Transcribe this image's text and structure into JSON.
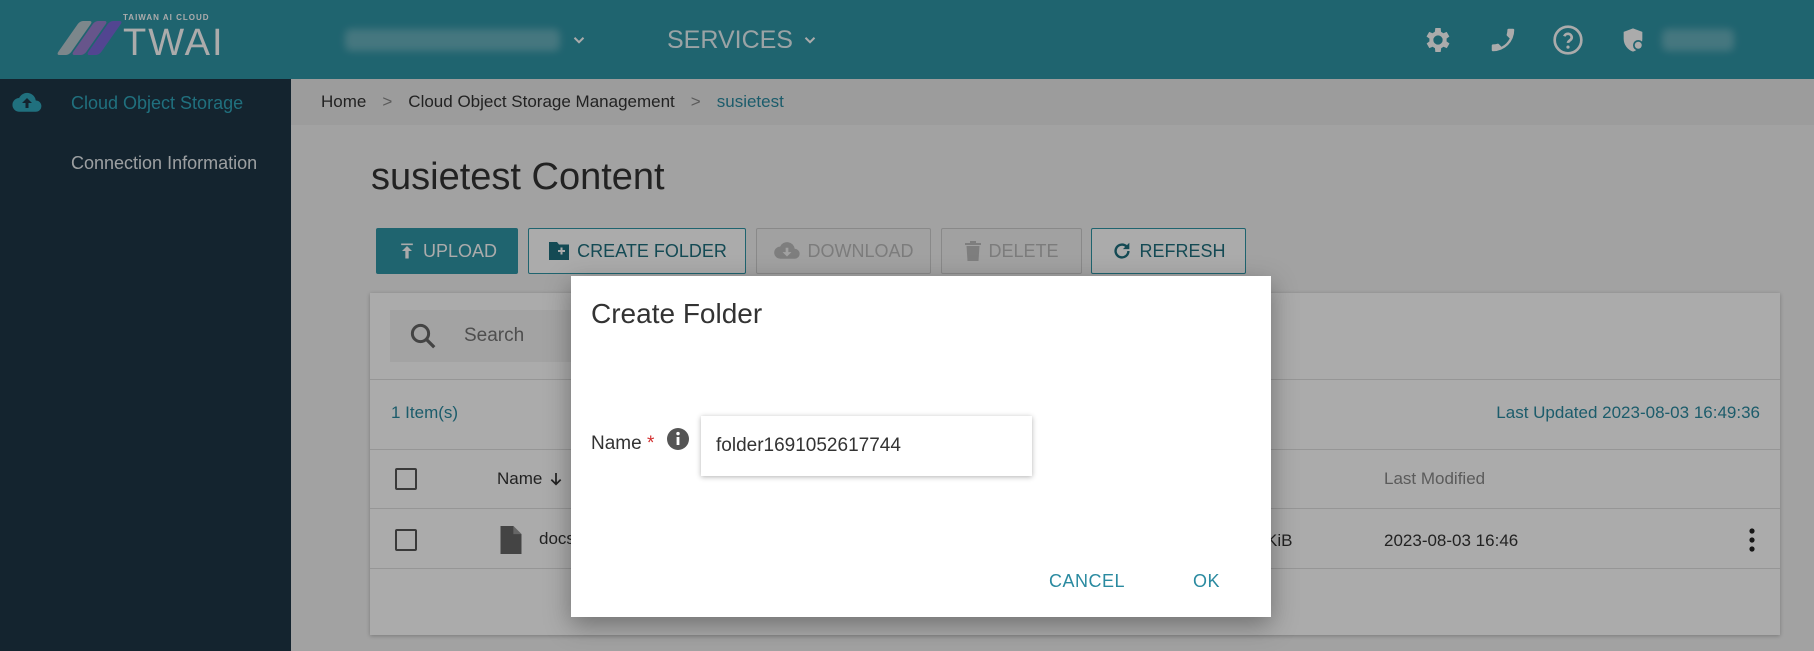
{
  "colors": {
    "primary": "#2f95a6",
    "sidebar": "#1e3646",
    "accent_text": "#2a8aa0",
    "required": "#d32f2f"
  },
  "header": {
    "logo_small": "TAIWAN AI CLOUD",
    "logo_main": "TWAI",
    "services_label": "SERVICES",
    "icons": [
      "gear-icon",
      "phone-icon",
      "help-icon",
      "user-shield-icon"
    ]
  },
  "sidebar": {
    "items": [
      {
        "label": "Cloud Object Storage",
        "icon": "cloud-upload-icon",
        "active": true
      },
      {
        "label": "Connection Information",
        "active": false
      }
    ]
  },
  "breadcrumb": {
    "items": [
      "Home",
      "Cloud Object Storage Management",
      "susietest"
    ],
    "separator": ">"
  },
  "page": {
    "title": "susietest Content"
  },
  "toolbar": {
    "upload": "UPLOAD",
    "create_folder": "CREATE FOLDER",
    "download": "DOWNLOAD",
    "delete": "DELETE",
    "refresh": "REFRESH"
  },
  "table": {
    "search_placeholder": "Search",
    "item_count": "1 Item(s)",
    "last_updated": "Last Updated 2023-08-03 16:49:36",
    "columns": {
      "name": "Name",
      "last_modified": "Last Modified"
    },
    "rows": [
      {
        "name": "docs",
        "size_fragment": "KiB",
        "last_modified": "2023-08-03 16:46"
      }
    ]
  },
  "dialog": {
    "title": "Create Folder",
    "field_label": "Name",
    "required_mark": "*",
    "field_value": "folder1691052617744",
    "cancel": "CANCEL",
    "ok": "OK"
  }
}
